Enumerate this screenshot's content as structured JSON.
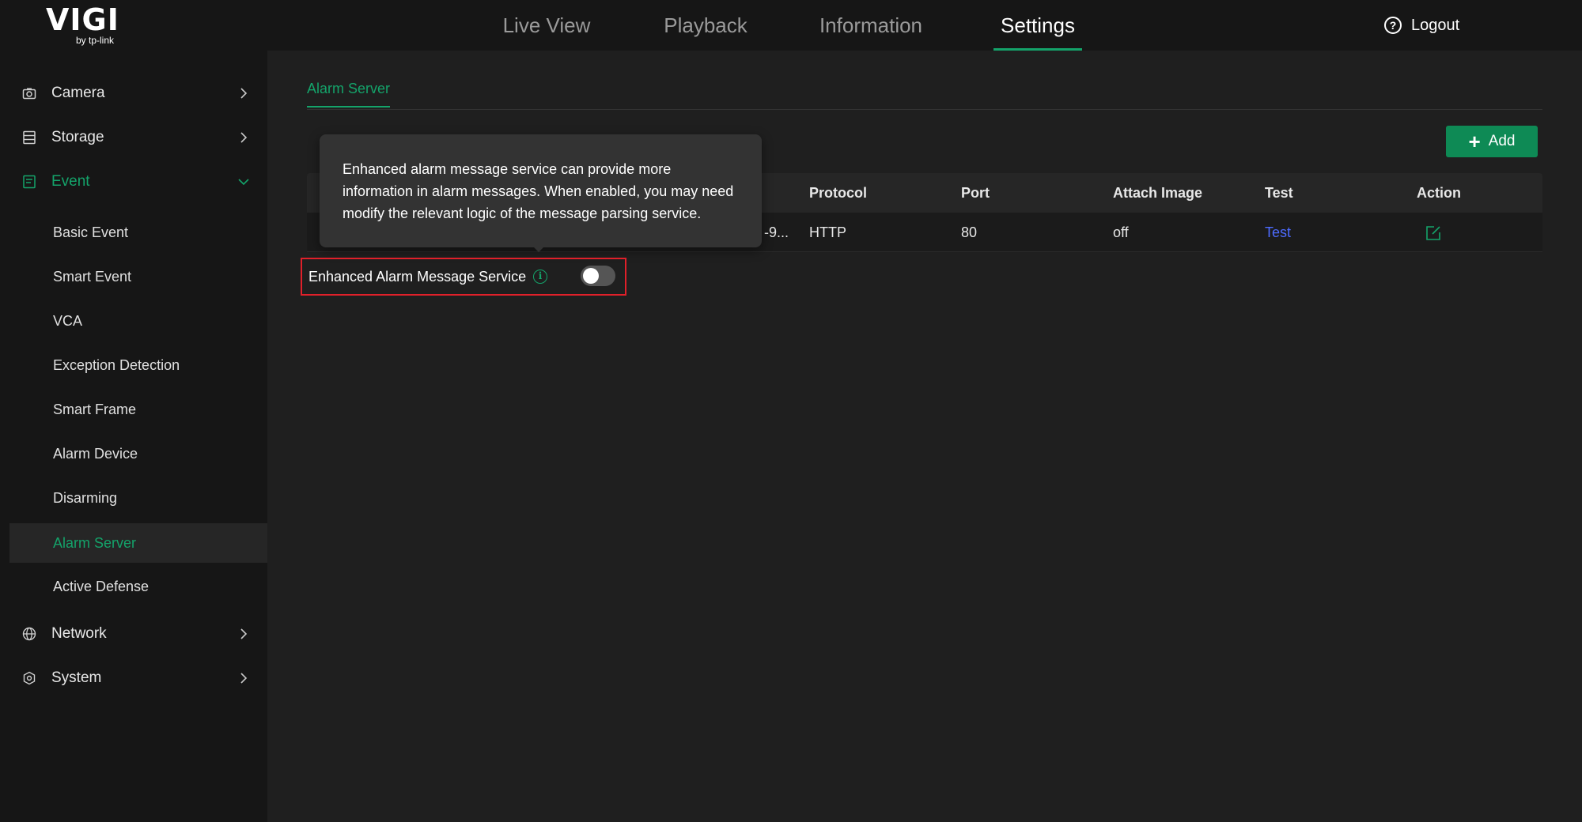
{
  "brand": {
    "logo": "VIGI",
    "byline": "by tp-link"
  },
  "nav": {
    "tabs": [
      {
        "label": "Live View"
      },
      {
        "label": "Playback"
      },
      {
        "label": "Information"
      },
      {
        "label": "Settings",
        "active": true
      }
    ],
    "logout": "Logout"
  },
  "sidebar": {
    "items": [
      {
        "label": "Camera",
        "icon": "camera-icon"
      },
      {
        "label": "Storage",
        "icon": "storage-icon"
      },
      {
        "label": "Event",
        "icon": "event-icon",
        "expanded": true
      },
      {
        "label": "Network",
        "icon": "globe-icon"
      },
      {
        "label": "System",
        "icon": "system-icon"
      }
    ],
    "event_sub": [
      {
        "label": "Basic Event"
      },
      {
        "label": "Smart Event"
      },
      {
        "label": "VCA"
      },
      {
        "label": "Exception Detection"
      },
      {
        "label": "Smart Frame"
      },
      {
        "label": "Alarm Device"
      },
      {
        "label": "Disarming"
      },
      {
        "label": "Alarm Server",
        "active": true
      },
      {
        "label": "Active Defense"
      }
    ]
  },
  "main": {
    "subtab": "Alarm Server",
    "add_label": "Add",
    "table": {
      "headers": {
        "protocol": "Protocol",
        "port": "Port",
        "attach_image": "Attach Image",
        "test": "Test",
        "action": "Action"
      },
      "rows": [
        {
          "truncated": "-9...",
          "protocol": "HTTP",
          "port": "80",
          "attach_image": "off",
          "test": "Test"
        }
      ]
    },
    "tooltip": "Enhanced alarm message service can provide more information in alarm messages. When enabled, you may need modify the relevant logic of the message parsing service.",
    "enhanced": {
      "label": "Enhanced Alarm Message Service",
      "enabled": false
    }
  },
  "colors": {
    "accent": "#14a36a",
    "link": "#4d6bff",
    "highlight_border": "#e0202a",
    "background": "#161616",
    "panel": "#1f1f1f"
  }
}
